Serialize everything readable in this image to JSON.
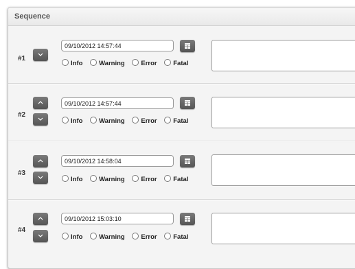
{
  "panel": {
    "title": "Sequence"
  },
  "rows": [
    {
      "num": "#1",
      "date": "09/10/2012 14:57:44",
      "has_up": false
    },
    {
      "num": "#2",
      "date": "09/10/2012 14:57:44",
      "has_up": true
    },
    {
      "num": "#3",
      "date": "09/10/2012 14:58:04",
      "has_up": true
    },
    {
      "num": "#4",
      "date": "09/10/2012 15:03:10",
      "has_up": true
    }
  ],
  "levels": [
    "Info",
    "Warning",
    "Error",
    "Fatal"
  ],
  "icons": {
    "up": "chevron-up-icon",
    "down": "chevron-down-icon",
    "calendar": "calendar-icon"
  },
  "colors": {
    "button": "#666666",
    "panel_bg": "#f4f4f4",
    "border": "#9a9a9a"
  }
}
